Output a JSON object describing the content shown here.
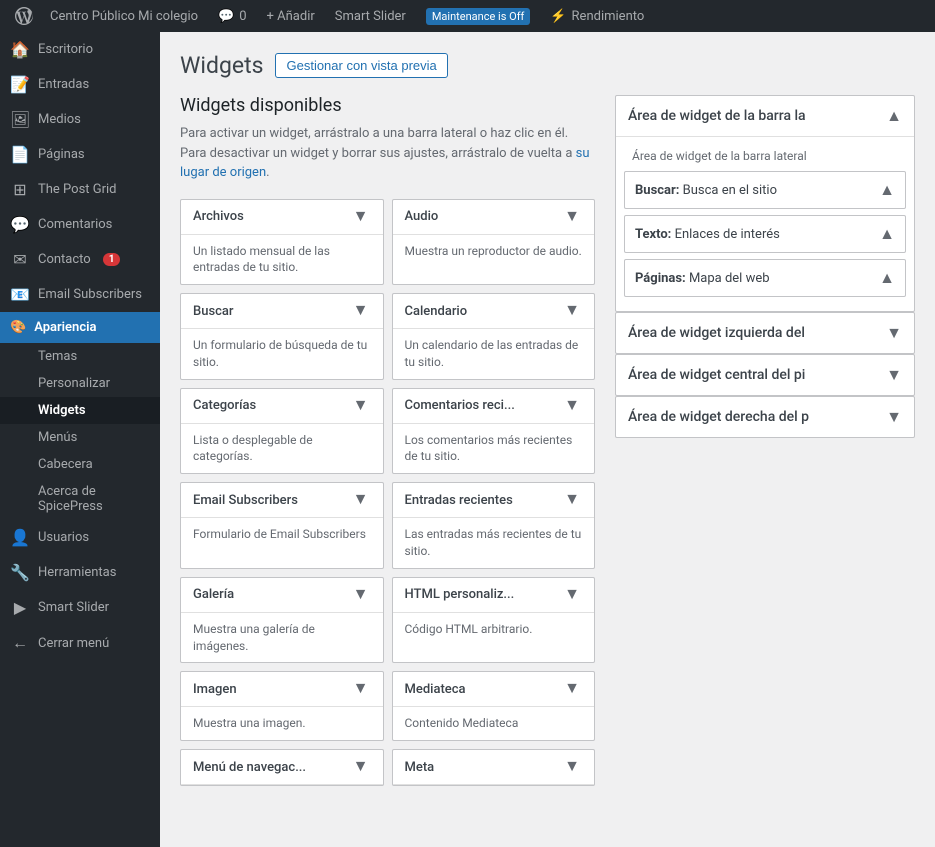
{
  "adminbar": {
    "wp_logo": "⊞",
    "site_name": "Centro Público Mi colegio",
    "comments_label": "Comentarios",
    "comments_count": "0",
    "add_label": "+ Añadir",
    "smart_slider_label": "Smart Slider",
    "maintenance_label": "Maintenance is Off",
    "performance_label": "Rendimiento"
  },
  "sidebar": {
    "escritorio": "Escritorio",
    "entradas": "Entradas",
    "medios": "Medios",
    "paginas": "Páginas",
    "the_post_grid": "The Post Grid",
    "comentarios": "Comentarios",
    "contacto": "Contacto",
    "contacto_badge": "1",
    "email_subscribers": "Email Subscribers",
    "apariencia": "Apariencia",
    "temas": "Temas",
    "personalizar": "Personalizar",
    "widgets": "Widgets",
    "menus": "Menús",
    "cabecera": "Cabecera",
    "acerca": "Acerca de SpicePress",
    "usuarios": "Usuarios",
    "herramientas": "Herramientas",
    "smart_slider": "Smart Slider",
    "cerrar_menu": "Cerrar menú"
  },
  "main": {
    "page_title": "Widgets",
    "manage_btn": "Gestionar con vista previa",
    "available_title": "Widgets disponibles",
    "available_desc_1": "Para activar un widget, arrástralo a una barra lateral o haz clic en él. Para desactivar un widget y borrar sus ajustes, arrástralo de vuelta a su lugar de origen.",
    "widgets": [
      {
        "title": "Archivos",
        "desc": "Un listado mensual de las entradas de tu sitio."
      },
      {
        "title": "Audio",
        "desc": "Muestra un reproductor de audio."
      },
      {
        "title": "Buscar",
        "desc": "Un formulario de búsqueda de tu sitio."
      },
      {
        "title": "Calendario",
        "desc": "Un calendario de las entradas de tu sitio."
      },
      {
        "title": "Categorías",
        "desc": "Lista o desplegable de categorías."
      },
      {
        "title": "Comentarios reci...",
        "desc": "Los comentarios más recientes de tu sitio."
      },
      {
        "title": "Email Subscribers",
        "desc": "Formulario de Email Subscribers"
      },
      {
        "title": "Entradas recientes",
        "desc": "Las entradas más recientes de tu sitio."
      },
      {
        "title": "Galería",
        "desc": "Muestra una galería de imágenes."
      },
      {
        "title": "HTML personaliz...",
        "desc": "Código HTML arbitrario."
      },
      {
        "title": "Imagen",
        "desc": "Muestra una imagen."
      },
      {
        "title": "Mediateca",
        "desc": "Contenido Mediateca"
      },
      {
        "title": "Menú de navegac...",
        "desc": ""
      },
      {
        "title": "Meta",
        "desc": ""
      }
    ]
  },
  "sidebar_areas": {
    "area1": {
      "title": "Área de widget de la barra la",
      "desc": "Área de widget de la barra lateral",
      "widgets": [
        {
          "label": "Buscar:",
          "name": "Busca en el sitio"
        },
        {
          "label": "Texto:",
          "name": "Enlaces de interés"
        },
        {
          "label": "Páginas:",
          "name": "Mapa del web"
        }
      ]
    },
    "area2": {
      "title": "Área de widget izquierda del"
    },
    "area3": {
      "title": "Área de widget central del pi"
    },
    "area4": {
      "title": "Área de widget derecha del p"
    }
  }
}
